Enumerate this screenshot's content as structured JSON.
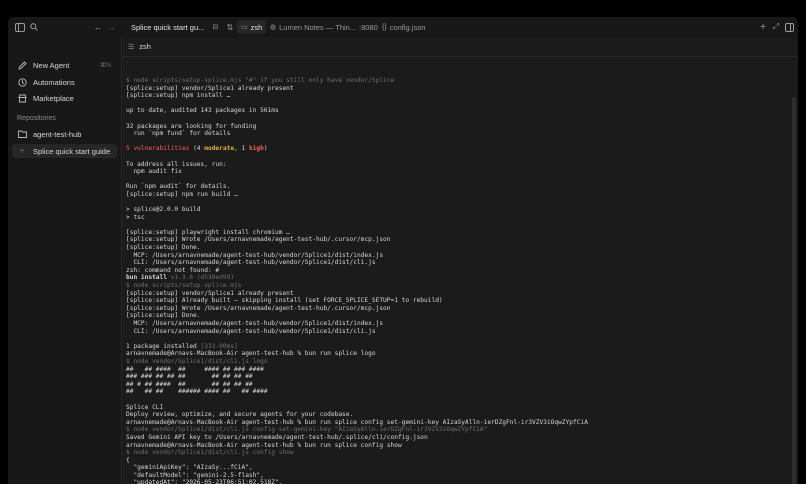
{
  "sidebar_top": {
    "toggle_icon": "sidebar-toggle-icon",
    "search_icon": "search-icon"
  },
  "nav": [
    {
      "label": "New Agent",
      "icon": "pencil-icon",
      "shortcut": "⌘N"
    },
    {
      "label": "Automations",
      "icon": "clock-icon"
    },
    {
      "label": "Marketplace",
      "icon": "store-icon"
    }
  ],
  "repositories": {
    "label": "Repositories",
    "items": [
      {
        "label": "agent-test-hub",
        "icon": "folder-icon"
      },
      {
        "label": "Splice quick start guide",
        "icon": "branch-icon"
      }
    ]
  },
  "tabs": [
    {
      "label": "Splice quick start gu..."
    },
    {
      "label": "zsh"
    },
    {
      "label": "Lumen Notes — Thin..."
    },
    {
      "label": ":8080"
    },
    {
      "label": "config.json"
    }
  ],
  "terminal": {
    "title": "zsh",
    "lines": [
      [
        {
          "t": "$ node scripts/setup-splice.mjs \"#\" if you still only have vendor/Splice",
          "c": "dim"
        }
      ],
      [
        {
          "t": "[splice:setup] vendor/Splice1 already present"
        }
      ],
      [
        {
          "t": "[splice:setup] npm install …"
        }
      ],
      [
        {
          "t": ""
        }
      ],
      [
        {
          "t": "up to date, audited 143 packages in 561ms"
        }
      ],
      [
        {
          "t": ""
        }
      ],
      [
        {
          "t": "32 packages are looking for funding"
        }
      ],
      [
        {
          "t": "  run `npm fund` for details"
        }
      ],
      [
        {
          "t": ""
        }
      ],
      [
        {
          "t": "5 vulnerabilities",
          "c": "red"
        },
        {
          "t": " (4 "
        },
        {
          "t": "moderate",
          "c": "yel bold"
        },
        {
          "t": ", 1 "
        },
        {
          "t": "high",
          "c": "red bold"
        },
        {
          "t": ")"
        }
      ],
      [
        {
          "t": ""
        }
      ],
      [
        {
          "t": "To address all issues, run:"
        }
      ],
      [
        {
          "t": "  npm audit fix"
        }
      ],
      [
        {
          "t": ""
        }
      ],
      [
        {
          "t": "Run `npm audit` for details."
        }
      ],
      [
        {
          "t": "[splice:setup] npm run build …"
        }
      ],
      [
        {
          "t": ""
        }
      ],
      [
        {
          "t": "> splice@2.0.0 build"
        }
      ],
      [
        {
          "t": "> tsc"
        }
      ],
      [
        {
          "t": ""
        }
      ],
      [
        {
          "t": "[splice:setup] playwright install chromium …"
        }
      ],
      [
        {
          "t": "[splice:setup] Wrote /Users/arnavnemade/agent-test-hub/.cursor/mcp.json"
        }
      ],
      [
        {
          "t": "[splice:setup] Done."
        }
      ],
      [
        {
          "t": "  MCP: /Users/arnavnemade/agent-test-hub/vendor/Splice1/dist/index.js"
        }
      ],
      [
        {
          "t": "  CLI: /Users/arnavnemade/agent-test-hub/vendor/Splice1/dist/cli.js"
        }
      ],
      [
        {
          "t": "zsh: command not found: #"
        }
      ],
      [
        {
          "t": "bun install",
          "c": "bold"
        },
        {
          "t": " v1.3.6 (d530ed99)",
          "c": "dim"
        }
      ],
      [
        {
          "t": "$ node scripts/setup-splice.mjs",
          "c": "dim"
        }
      ],
      [
        {
          "t": "[splice:setup] vendor/Splice1 already present"
        }
      ],
      [
        {
          "t": "[splice:setup] Already built — skipping install (set FORCE_SPLICE_SETUP=1 to rebuild)"
        }
      ],
      [
        {
          "t": "[splice:setup] Wrote /Users/arnavnemade/agent-test-hub/.cursor/mcp.json"
        }
      ],
      [
        {
          "t": "[splice:setup] Done."
        }
      ],
      [
        {
          "t": "  MCP: /Users/arnavnemade/agent-test-hub/vendor/Splice1/dist/index.js"
        }
      ],
      [
        {
          "t": "  CLI: /Users/arnavnemade/agent-test-hub/vendor/Splice1/dist/cli.js"
        }
      ],
      [
        {
          "t": ""
        }
      ],
      [
        {
          "t": "1 package installed "
        },
        {
          "t": "[333.00ms]",
          "c": "dim"
        }
      ],
      [
        {
          "t": "arnavnemade@Arnavs-MacBook-Air agent-test-hub % bun run splice logo"
        }
      ],
      [
        {
          "t": "$ node vendor/Splice1/dist/cli.js logo",
          "c": "dim"
        }
      ],
      [
        {
          "t": "##   ## ####  ##     #### ## ### ####"
        }
      ],
      [
        {
          "t": "### ### ## ## ##       ## ## ## ##"
        }
      ],
      [
        {
          "t": "## # ## ####  ##       ## ## ## ##"
        }
      ],
      [
        {
          "t": "##   ## ##    ###### #### ##   ## ####"
        }
      ],
      [
        {
          "t": ""
        }
      ],
      [
        {
          "t": "Splice CLI"
        }
      ],
      [
        {
          "t": "Deploy review, optimize, and secure agents for your codebase."
        }
      ],
      [
        {
          "t": "arnavnemade@Arnavs-MacBook-Air agent-test-hub % bun run splice config set-gemini-key AIzaSyAlln-ierDZgFnl-ir3VZV3iOqwZYpfCiA"
        }
      ],
      [
        {
          "t": "$ node vendor/Splice1/dist/cli.js config set-gemini-key \"AIzaSyAlln-ierDZgFnl-ir3VZV3iOqwZYpfCiA\"",
          "c": "dim"
        }
      ],
      [
        {
          "t": "Saved Gemini API key to /Users/arnavnemade/agent-test-hub/.splice/cli/config.json"
        }
      ],
      [
        {
          "t": "arnavnemade@Arnavs-MacBook-Air agent-test-hub % bun run splice config show"
        }
      ],
      [
        {
          "t": "$ node vendor/Splice1/dist/cli.js config show",
          "c": "dim"
        }
      ],
      [
        {
          "t": "{"
        }
      ],
      [
        {
          "t": "  \"geminiApiKey\": \"AIzaSy...fCiA\","
        }
      ],
      [
        {
          "t": "  \"defaultModel\": \"gemini-2.5-flash\","
        }
      ],
      [
        {
          "t": "  \"updatedAt\": \"2026-05-23T06:51:02.518Z\","
        }
      ]
    ]
  },
  "colors": {
    "background": "#000000",
    "window": "#181818",
    "terminal_bg": "#1b1b1b",
    "text": "#d6d6d6",
    "dim": "#6f6f6f",
    "red": "#ff5f5f",
    "yellow": "#e0b53c"
  }
}
